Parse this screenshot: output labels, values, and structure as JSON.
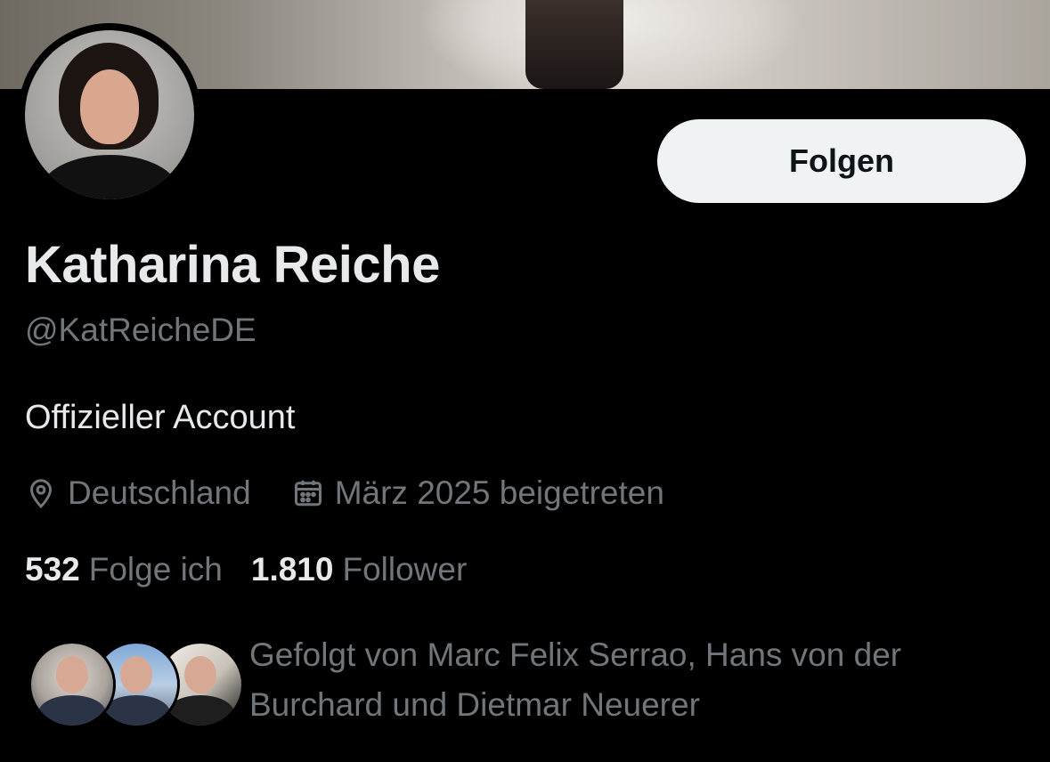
{
  "profile": {
    "name": "Katharina Reiche",
    "handle": "@KatReicheDE",
    "bio": "Offizieller Account",
    "location": "Deutschland",
    "joined": "März 2025 beigetreten"
  },
  "actions": {
    "follow_label": "Folgen"
  },
  "stats": {
    "following_count": "532",
    "following_label": "Folge ich",
    "followers_count": "1.810",
    "followers_label": "Follower"
  },
  "followed_by": {
    "text": "Gefolgt von Marc Felix Serrao, Hans von der Burchard und Dietmar Neuerer"
  },
  "icons": {
    "location": "location-pin-icon",
    "joined": "calendar-icon"
  },
  "colors": {
    "background": "#000000",
    "primary_text": "#e7e9ea",
    "secondary_text": "#71767b",
    "button_bg": "#eff3f4",
    "button_text": "#0f1419"
  }
}
